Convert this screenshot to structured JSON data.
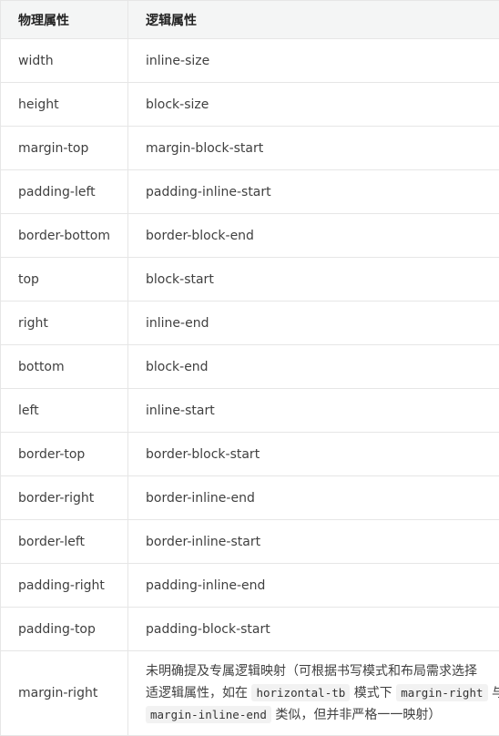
{
  "table": {
    "headers": {
      "physical": "物理属性",
      "logical": "逻辑属性"
    },
    "rows": [
      {
        "physical": "width",
        "logical": "inline-size"
      },
      {
        "physical": "height",
        "logical": "block-size"
      },
      {
        "physical": "margin-top",
        "logical": "margin-block-start"
      },
      {
        "physical": "padding-left",
        "logical": "padding-inline-start"
      },
      {
        "physical": "border-bottom",
        "logical": "border-block-end"
      },
      {
        "physical": "top",
        "logical": "block-start"
      },
      {
        "physical": "right",
        "logical": "inline-end"
      },
      {
        "physical": "bottom",
        "logical": "block-end"
      },
      {
        "physical": "left",
        "logical": "inline-start"
      },
      {
        "physical": "border-top",
        "logical": "border-block-start"
      },
      {
        "physical": "border-right",
        "logical": "border-inline-end"
      },
      {
        "physical": "border-left",
        "logical": "border-inline-start"
      },
      {
        "physical": "padding-right",
        "logical": "padding-inline-end"
      },
      {
        "physical": "padding-top",
        "logical": "padding-block-start"
      }
    ],
    "note_row": {
      "physical": "margin-right",
      "line1": "未明确提及专属逻辑映射（可根据书写模式和布局需求选择",
      "line2_text_a": "适逻辑属性，如在",
      "line2_code_a": "horizontal-tb",
      "line2_text_b": "模式下",
      "line2_code_b": "margin-right",
      "line2_text_c": "与",
      "line3_code": "margin-inline-end",
      "line3_text": "类似，但并非严格一一映射）"
    }
  }
}
